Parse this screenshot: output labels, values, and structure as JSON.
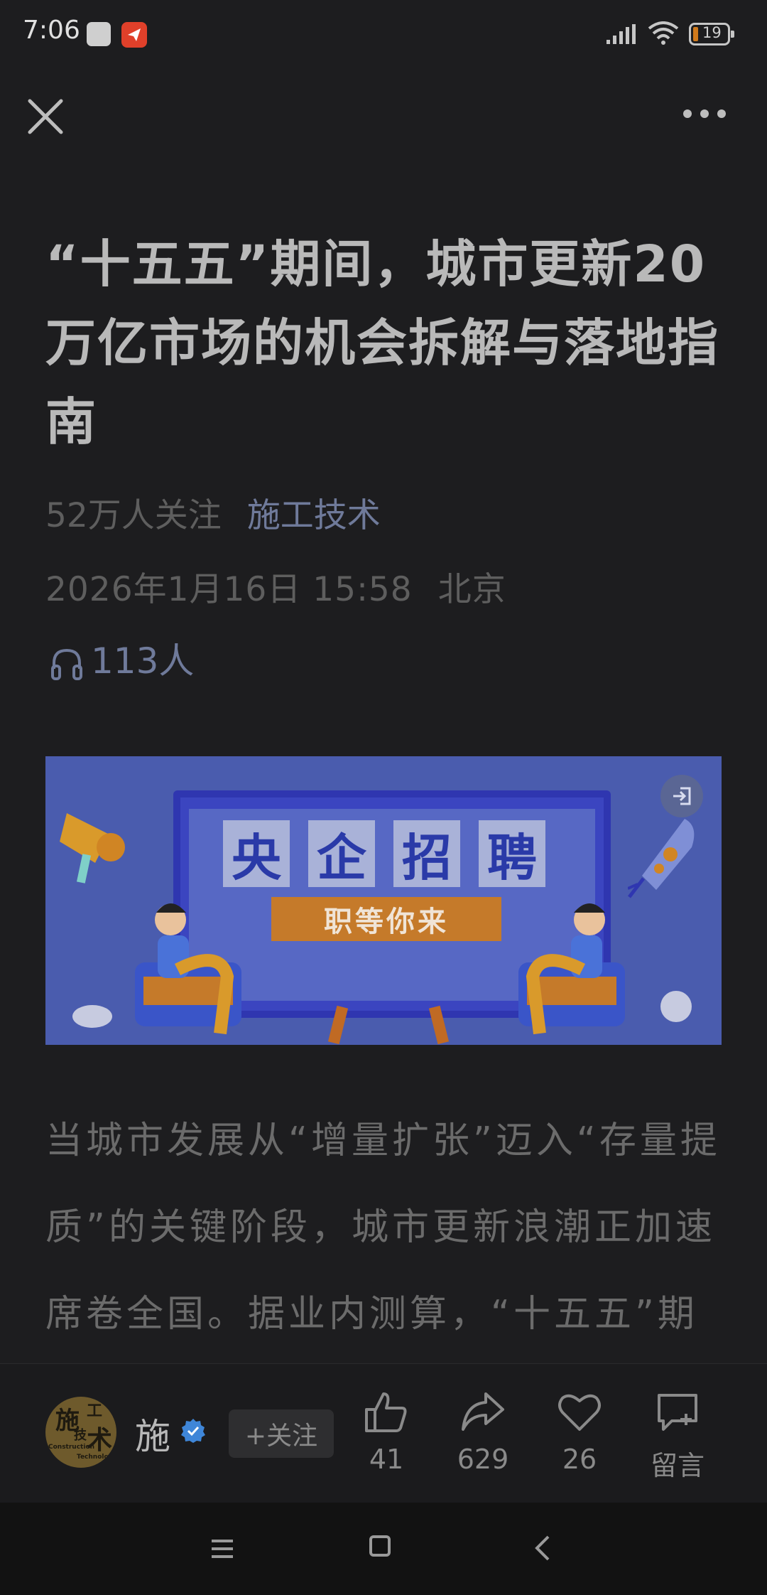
{
  "status_bar": {
    "time": "7:06",
    "battery": "19"
  },
  "article": {
    "title": "“十五五”期间，城市更新20万亿市场的机会拆解与落地指南",
    "followers": "52万人关注",
    "channel": "施工技术",
    "date": "2026年1月16日 15:58",
    "location": "北京",
    "listeners": "113人",
    "body": "当城市发展从“增量扩张”迈入“存量提质”的关键阶段，城市更新浪潮正加速席卷全国。据业内测算，“十五五”期间"
  },
  "banner": {
    "chars": [
      "央",
      "企",
      "招",
      "聘"
    ],
    "slogan": "职等你来"
  },
  "author": {
    "name": "施",
    "follow_label": "+关注",
    "avatar_text": [
      "施",
      "工",
      "技",
      "术",
      "Construction",
      "Technology"
    ]
  },
  "actions": {
    "like_count": "41",
    "share_count": "629",
    "favorite_count": "26",
    "comment_label": "留言"
  },
  "colors": {
    "background": "#1d1d1f",
    "channel_link": "#6f7a9a",
    "banner_bg": "#4a5cae",
    "slogan_bg": "#c57a2a",
    "verified": "#3f86d8"
  }
}
